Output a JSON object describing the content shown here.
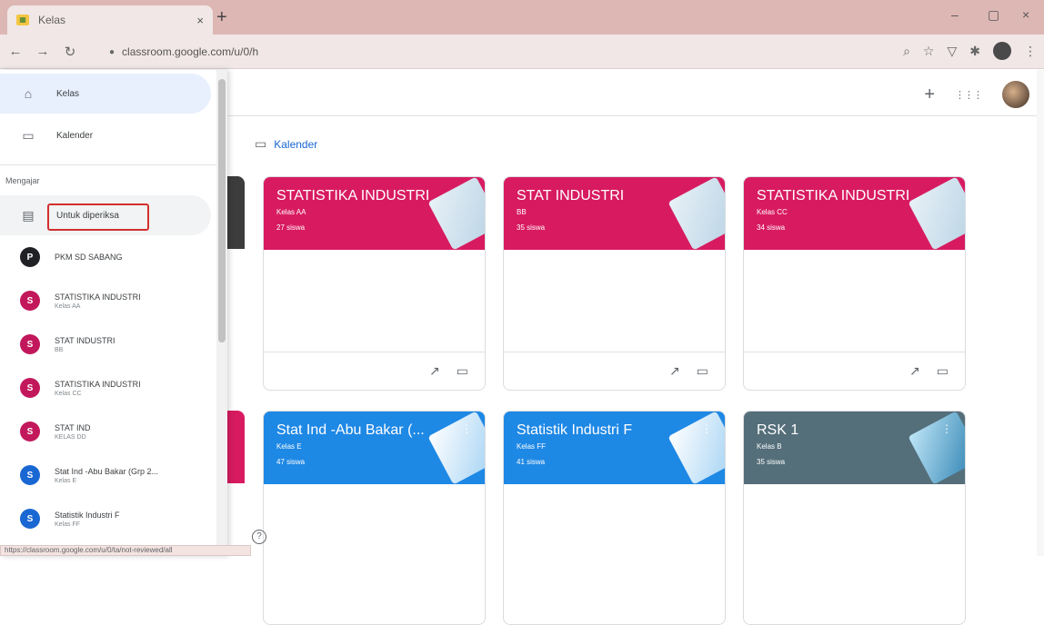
{
  "browser": {
    "tab_title": "Kelas",
    "tab_close": "×",
    "new_tab": "+",
    "url": "classroom.google.com/u/0/h",
    "window_minimize": "–",
    "window_maximize": "▢",
    "window_close": "×"
  },
  "topbar": {
    "add": "+",
    "apps": "⋮⋮⋮"
  },
  "breadcrumb": {
    "calendar_label": "Kalender"
  },
  "sidebar": {
    "nav": [
      {
        "label": "Kelas",
        "icon": "home-icon"
      },
      {
        "label": "Kalender",
        "icon": "calendar-icon"
      }
    ],
    "section_label": "Mengajar",
    "review_label": "Untuk diperiksa",
    "classes": [
      {
        "initial": "P",
        "name": "PKM SD SABANG",
        "sub": "",
        "color": "#202124"
      },
      {
        "initial": "S",
        "name": "STATISTIKA INDUSTRI",
        "sub": "Kelas AA",
        "color": "#c2185b"
      },
      {
        "initial": "S",
        "name": "STAT INDUSTRI",
        "sub": "BB",
        "color": "#c2185b"
      },
      {
        "initial": "S",
        "name": "STATISTIKA INDUSTRI",
        "sub": "Kelas CC",
        "color": "#c2185b"
      },
      {
        "initial": "S",
        "name": "STAT IND",
        "sub": "KELAS DD",
        "color": "#c2185b"
      },
      {
        "initial": "S",
        "name": "Stat Ind -Abu Bakar (Grp 2...",
        "sub": "Kelas E",
        "color": "#1967d2"
      },
      {
        "initial": "S",
        "name": "Statistik Industri F",
        "sub": "Kelas FF",
        "color": "#1967d2"
      }
    ]
  },
  "cards": [
    {
      "title": "STATISTIKA INDUSTRI",
      "sub": "Kelas AA",
      "count": "27 siswa",
      "color": "#d81b60"
    },
    {
      "title": "STAT INDUSTRI",
      "sub": "BB",
      "count": "35 siswa",
      "color": "#d81b60"
    },
    {
      "title": "STATISTIKA INDUSTRI",
      "sub": "Kelas CC",
      "count": "34 siswa",
      "color": "#d81b60"
    },
    {
      "title": "Stat Ind -Abu Bakar (...",
      "sub": "Kelas E",
      "count": "47 siswa",
      "color": "#1e88e5"
    },
    {
      "title": "Statistik Industri F",
      "sub": "Kelas FF",
      "count": "41 siswa",
      "color": "#1e88e5"
    },
    {
      "title": "RSK 1",
      "sub": "Kelas B",
      "count": "35 siswa",
      "color": "#546e7a"
    }
  ],
  "help": "?",
  "status_url": "https://classroom.google.com/u/0/ta/not-reviewed/all"
}
